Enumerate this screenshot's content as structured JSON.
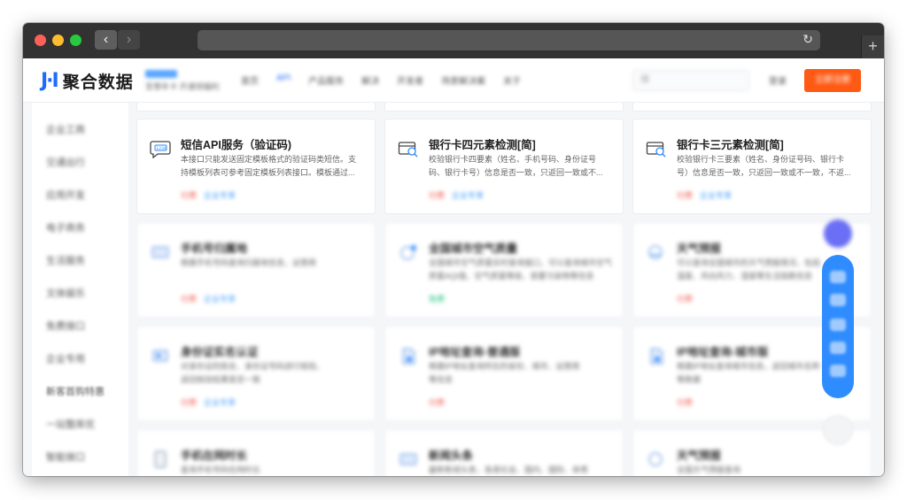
{
  "browser": {
    "back_icon": "chevron-left-icon",
    "back_glyph": "‹",
    "forward_glyph": "›",
    "reload_glyph": "↻",
    "newtab_glyph": "+"
  },
  "header": {
    "logo_mark": "J·I",
    "logo_text": "聚合数据",
    "promo_sub": "至尊年卡 开通领福利",
    "menu": [
      "首页",
      "API",
      "产品服务",
      "解决",
      "开发者",
      "场景解决案",
      "关于"
    ],
    "search_placeholder": "搜",
    "login": "登录",
    "signup": "立即注册"
  },
  "sidebar": {
    "items": [
      "企业工商",
      "交通出行",
      "应用开发",
      "电子商务",
      "生活服务",
      "文体娱乐",
      "免费接口",
      "企业专用",
      "新客首购特惠",
      "一站整库优",
      "智能接口"
    ]
  },
  "cards": [
    {
      "title": "短信API服务（验证码)",
      "desc1": "本接口只能发送固定模板格式的验证码类短信。支",
      "desc2": "持模板列表可参考固定模板列表接口。模板通过...",
      "tag1": "付费",
      "tag2": "企业专享",
      "icon": "sms-icon"
    },
    {
      "title": "银行卡四元素检测[简]",
      "desc1": "校验银行卡四要素（姓名、手机号码、身份证号",
      "desc2": "码、银行卡号）信息是否一致，只返回一致或不...",
      "tag1": "付费",
      "tag2": "企业专享",
      "icon": "bank-card-icon"
    },
    {
      "title": "银行卡三元素检测[简]",
      "desc1": "校验银行卡三要素（姓名、身份证号码、银行卡",
      "desc2": "号）信息是否一致，只返回一致或不一致，不返...",
      "tag1": "付费",
      "tag2": "企业专享",
      "icon": "bank-card-icon"
    },
    {
      "title": "手机号归属地",
      "desc1": "根据手机号码查询归属地信息，运营商",
      "desc2": "",
      "tag1": "付费",
      "tag2": "企业专享",
      "icon": "phone-icon"
    },
    {
      "title": "全国城市空气质量",
      "desc1": "全国城市空气质量实时查询接口，可以查询城市空气",
      "desc2": "质量AQI值、空气质量等级、首要污染物等信息",
      "tag1": "免费",
      "tag2": "",
      "icon": "air-quality-icon"
    },
    {
      "title": "天气预报",
      "desc1": "可以查询全国城市的天气预报情况，包括",
      "desc2": "温度、风向风力、湿度等生活指数信息",
      "tag1": "付费",
      "tag2": "",
      "icon": "weather-icon"
    },
    {
      "title": "身份证实名认证",
      "desc1": "对身份证的姓名、身份证号码进行核验，",
      "desc2": "返回核验结果是否一致",
      "tag1": "付费",
      "tag2": "企业专享",
      "icon": "id-card-icon"
    },
    {
      "title": "IP地址查询-普通版",
      "desc1": "根据IP地址查询所在的省份、城市、运营商",
      "desc2": "等信息",
      "tag1": "付费",
      "tag2": "",
      "icon": "ip-address-icon"
    },
    {
      "title": "IP地址查询-城市版",
      "desc1": "根据IP地址查询城市信息，返回城市名称",
      "desc2": "等数据",
      "tag1": "付费",
      "tag2": "",
      "icon": "ip-address-icon"
    },
    {
      "title": "手机在网时长",
      "desc1": "查询手机号码在网时长",
      "desc2": "",
      "tag1": "",
      "tag2": "",
      "icon": "phone-icon"
    },
    {
      "title": "新闻头条",
      "desc1": "最新新闻头条，各类社会、国内、国际、体育",
      "desc2": "",
      "tag1": "",
      "tag2": "",
      "icon": "news-icon"
    },
    {
      "title": "天气预报",
      "desc1": "全国天气预报查询",
      "desc2": "",
      "tag1": "",
      "tag2": "",
      "icon": "weather-icon"
    }
  ],
  "colors": {
    "accent": "#1e6cff",
    "signup": "#ff5a14",
    "tag_red": "#f25a4c",
    "tag_blue": "#3f9cff",
    "tag_green": "#19c07a",
    "float_bar": "#2f8cff"
  }
}
